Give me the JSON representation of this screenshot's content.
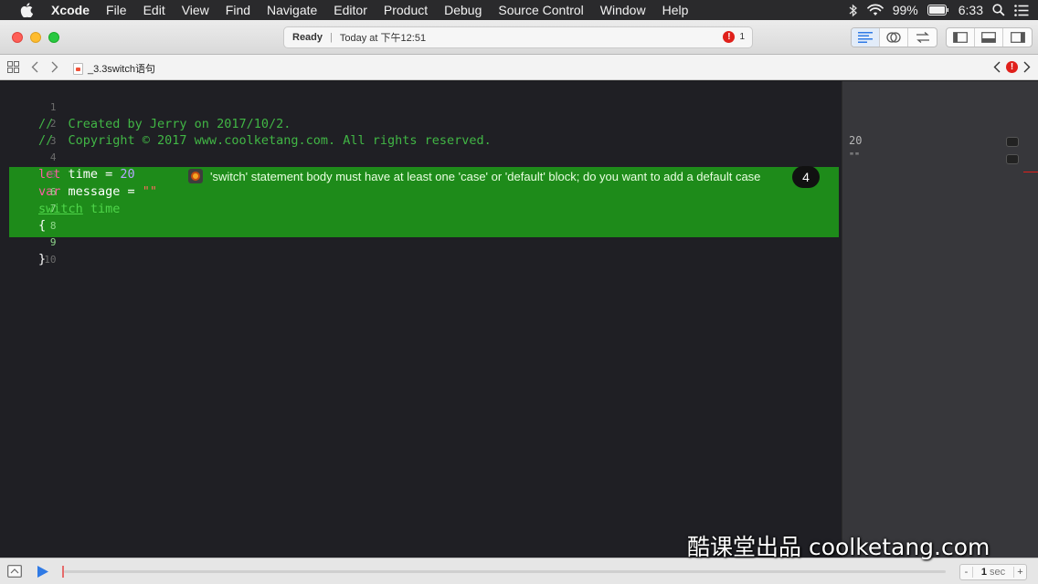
{
  "menubar": {
    "app_name": "Xcode",
    "items": [
      "File",
      "Edit",
      "View",
      "Find",
      "Navigate",
      "Editor",
      "Product",
      "Debug",
      "Source Control",
      "Window",
      "Help"
    ],
    "battery": "99%",
    "clock": "6:33"
  },
  "toolbar": {
    "status": "Ready",
    "timestamp": "Today at 下午12:51",
    "error_count": "1"
  },
  "jumpbar": {
    "file": "_3.3switch语句"
  },
  "editor": {
    "lines": [
      {
        "num": "1",
        "text": "//  Created by Jerry on 2017/10/2."
      },
      {
        "num": "2",
        "text": "//  Copyright © 2017 www.coolketang.com. All rights reserved."
      },
      {
        "num": "3",
        "text": ""
      },
      {
        "num": "4",
        "keyword": "let",
        "ident": " time = ",
        "value": "20"
      },
      {
        "num": "5",
        "keyword": "var",
        "ident": " message = ",
        "value": "\"\""
      },
      {
        "num": "6",
        "keyword": "switch",
        "ident": " time"
      },
      {
        "num": "7",
        "text": "{"
      },
      {
        "num": "8",
        "text": ""
      },
      {
        "num": "9",
        "text": "}"
      },
      {
        "num": "10",
        "text": ""
      }
    ],
    "error_message": "'switch' statement body must have at least one 'case' or 'default' block; do you want to add a default case",
    "step_badge": "4"
  },
  "results": {
    "line4": "20",
    "line5": "\"\""
  },
  "debugbar": {
    "minus": "-",
    "value": "1",
    "unit": "sec",
    "plus": "+"
  },
  "watermark": "酷课堂出品 coolketang.com",
  "colors": {
    "comment": "#41b645",
    "keyword": "#fc5fa3",
    "number": "#d0bf69",
    "string": "#fc6a5d",
    "error_band": "#1e8b1a"
  }
}
